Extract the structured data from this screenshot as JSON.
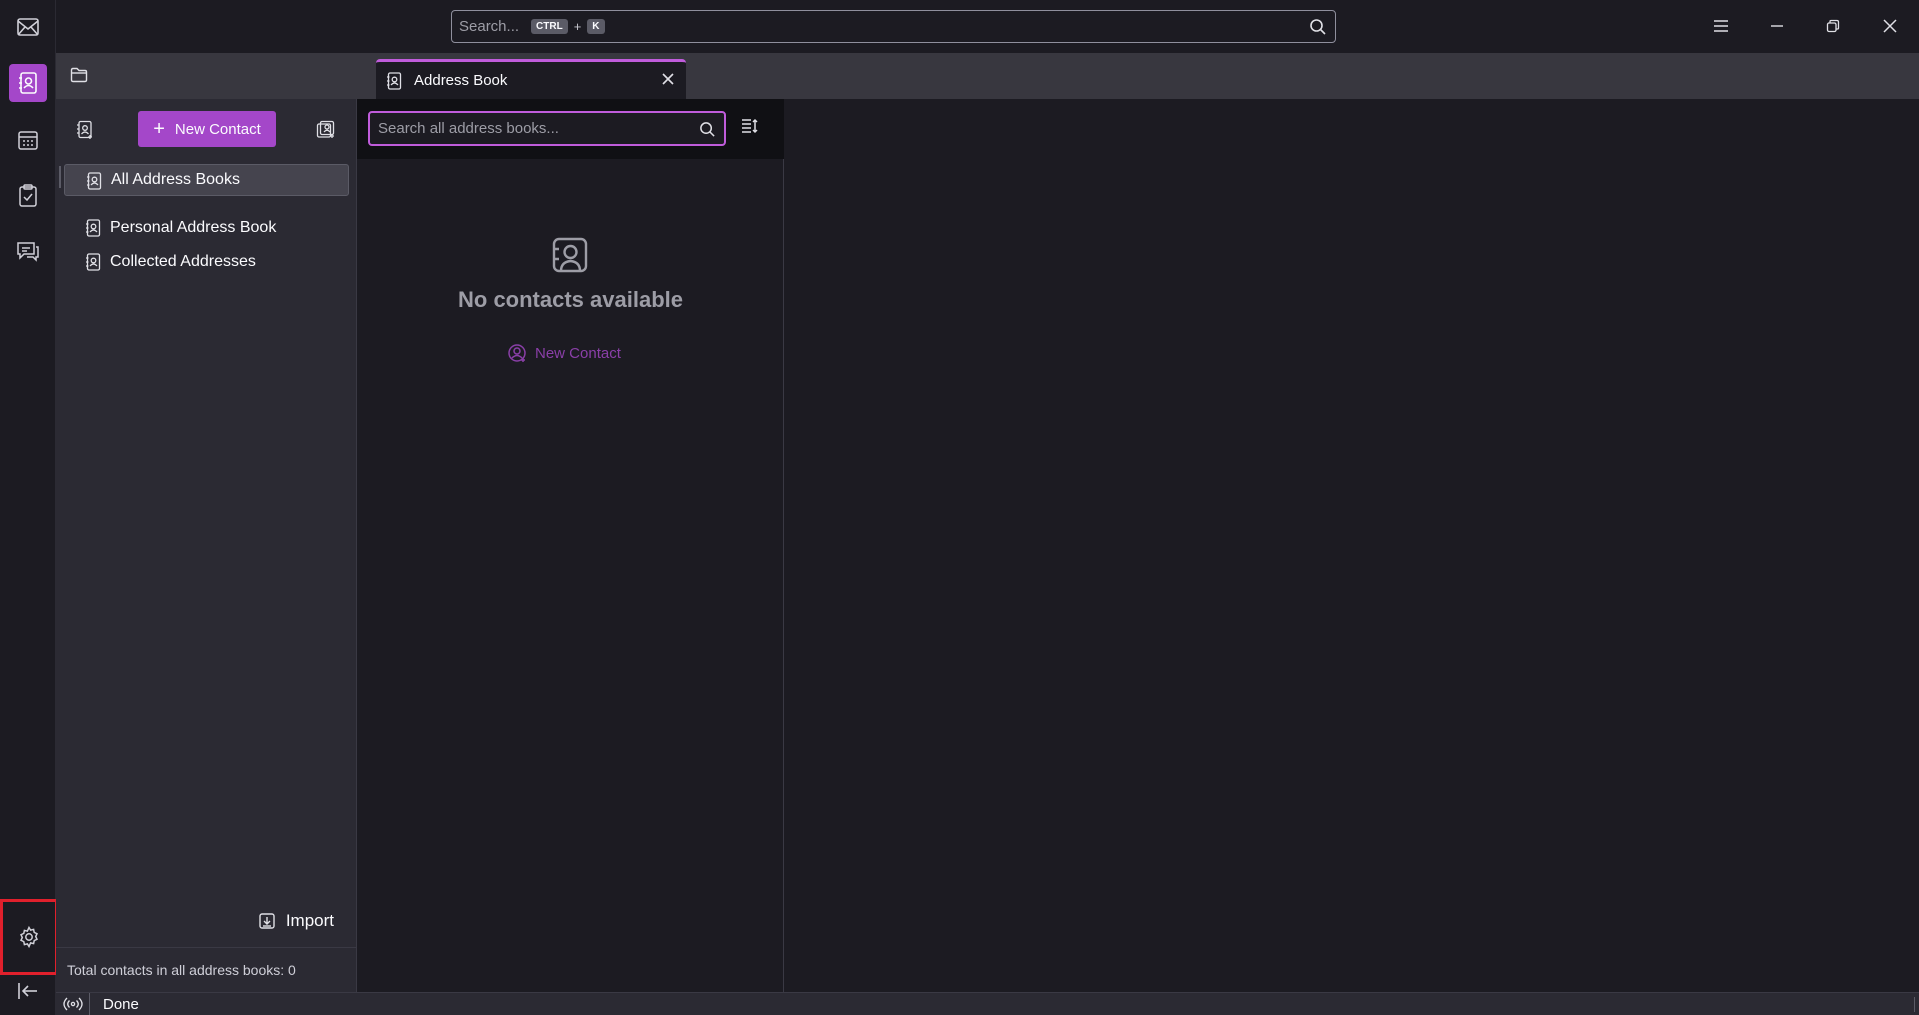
{
  "global_search": {
    "placeholder": "Search...",
    "shortcut_key1": "CTRL",
    "shortcut_plus": "+",
    "shortcut_key2": "K"
  },
  "tabs": [
    {
      "label": "Address Book",
      "active": true
    }
  ],
  "books_toolbar": {
    "new_contact_label": "New Contact"
  },
  "address_books": [
    {
      "label": "All Address Books",
      "selected": true
    },
    {
      "label": "Personal Address Book",
      "selected": false
    },
    {
      "label": "Collected Addresses",
      "selected": false
    }
  ],
  "import_label": "Import",
  "total_contacts_label": "Total contacts in all address books: 0",
  "cards": {
    "search_placeholder": "Search all address books...",
    "empty_title": "No contacts available",
    "empty_new_contact": "New Contact"
  },
  "status": {
    "text": "Done"
  },
  "colors": {
    "accent": "#a447c9",
    "accent_focus": "#c05cdb",
    "highlight_box": "#e0202c",
    "background": "#1c1b22",
    "pane": "#2b2a33"
  },
  "icons": {
    "spaces": [
      "mail-icon",
      "address-book-icon",
      "calendar-icon",
      "tasks-icon",
      "chat-icon",
      "settings-icon",
      "collapse-icon"
    ]
  }
}
